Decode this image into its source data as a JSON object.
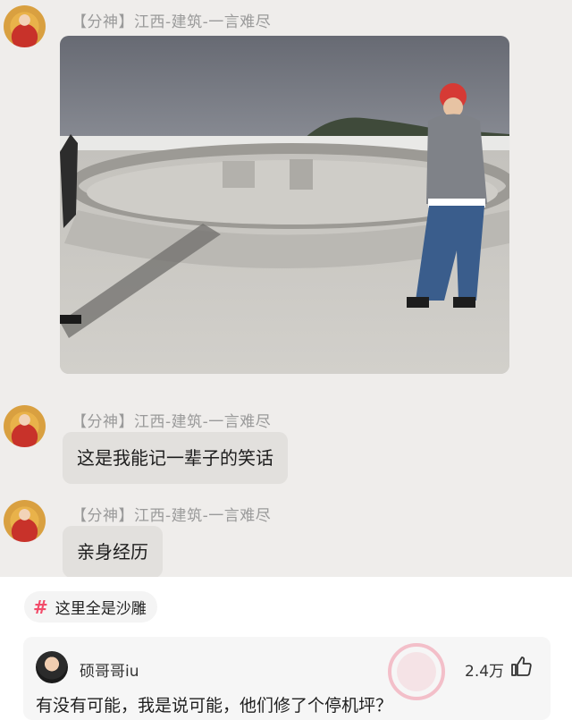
{
  "messages": [
    {
      "sender": "【分神】江西-建筑-一言难尽",
      "type": "image"
    },
    {
      "sender": "【分神】江西-建筑-一言难尽",
      "type": "text",
      "text": "这是我能记一辈子的笑话"
    },
    {
      "sender": "【分神】江西-建筑-一言难尽",
      "type": "text",
      "text": "亲身经历"
    }
  ],
  "topic": {
    "label": "这里全是沙雕"
  },
  "comment": {
    "author": "硕哥哥iu",
    "likes": "2.4万",
    "text": "有没有可能，我是说可能，他们修了个停机坪？"
  },
  "icons": {
    "topic": "hashtag-icon",
    "like": "thumbs-up-icon",
    "watermark": "stamp-watermark"
  },
  "colors": {
    "chat_bg": "#efedeb",
    "bubble_bg": "#e2e0dd",
    "hashtag_accent": "#f24c6a"
  }
}
